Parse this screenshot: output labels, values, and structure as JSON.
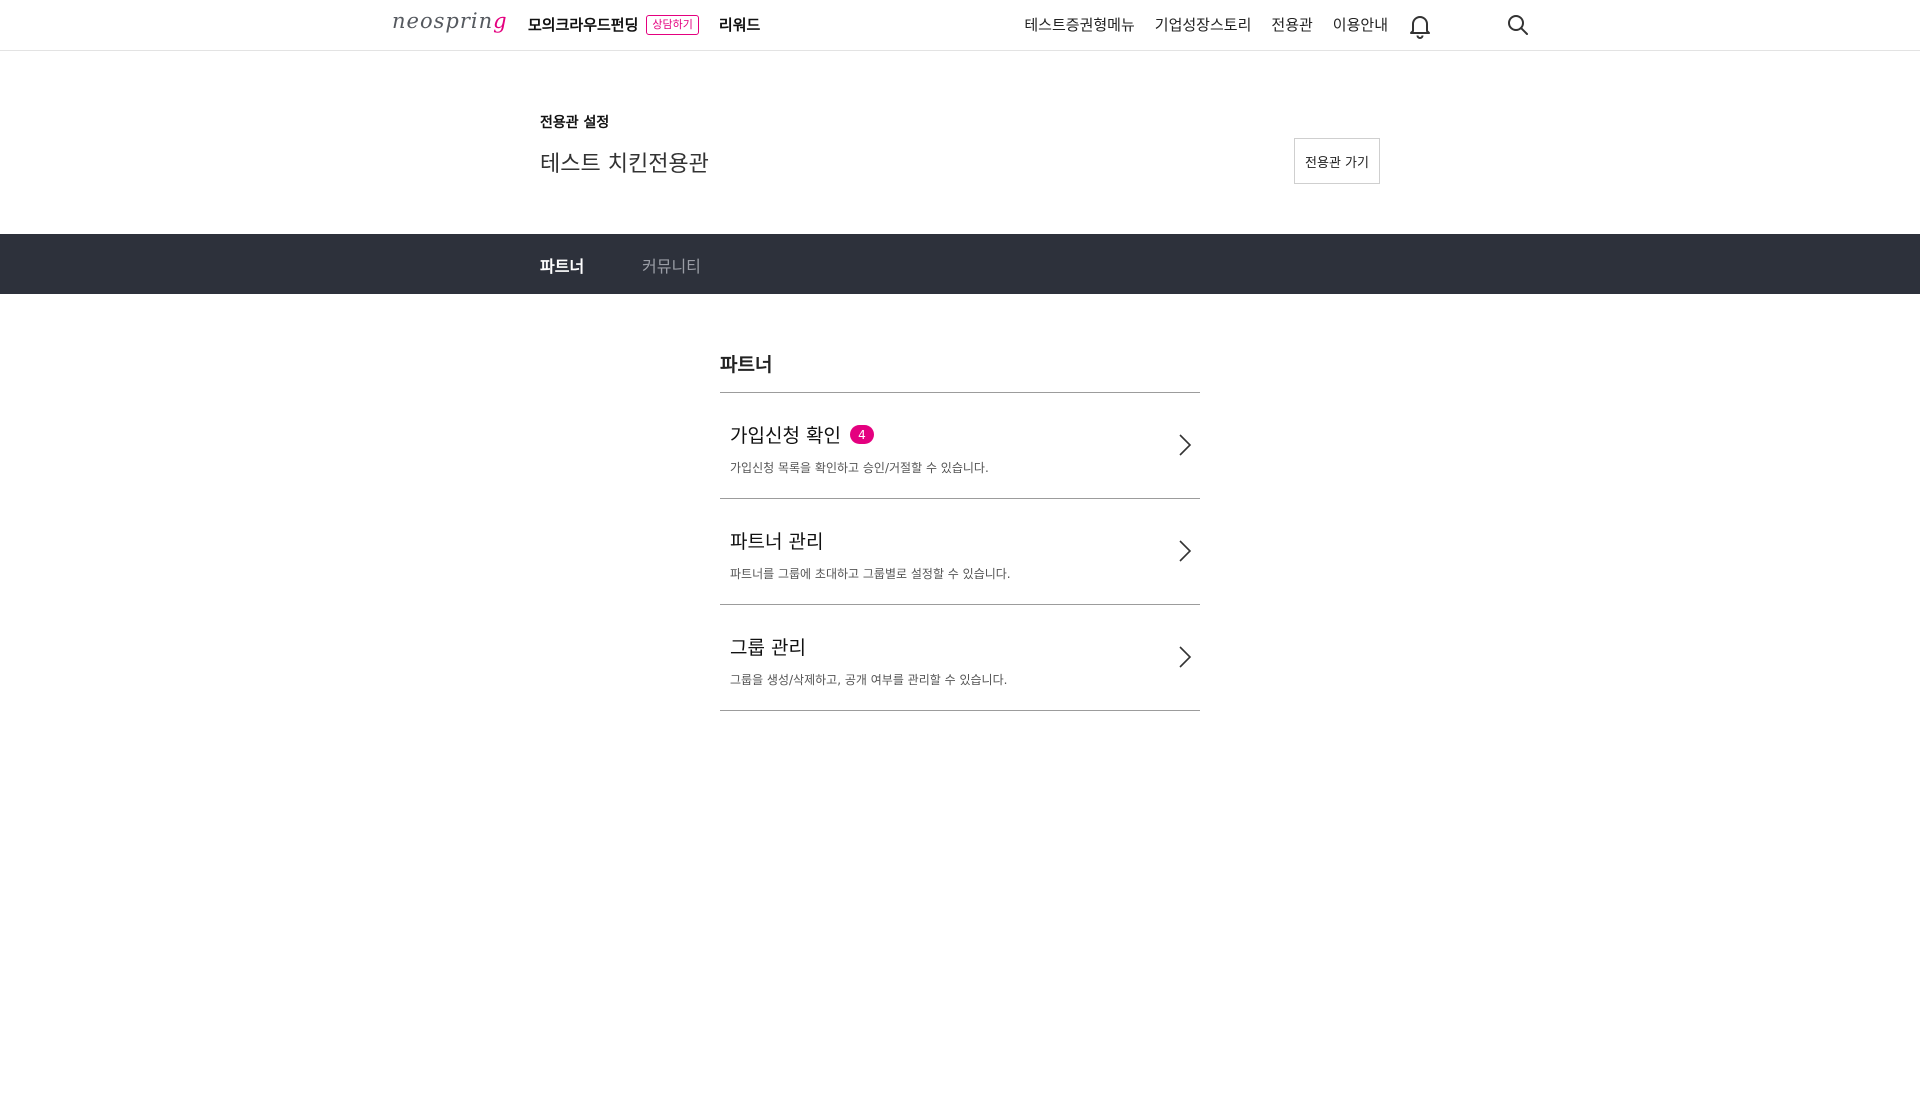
{
  "header": {
    "logo": {
      "main": "neosprin",
      "accent": "g"
    },
    "nav_left": {
      "mock_crowd": "모의크라우드펀딩",
      "consult": "상담하기",
      "reward": "리워드"
    },
    "nav_right": [
      "테스트증권형메뉴",
      "기업성장스토리",
      "전용관",
      "이용안내"
    ],
    "icons": [
      "bell-icon",
      "search-icon"
    ]
  },
  "settings": {
    "crumb": "전용관 설정",
    "title": "테스트 치킨전용관",
    "goto_label": "전용관 가기"
  },
  "tabs": [
    {
      "label": "파트너",
      "active": true
    },
    {
      "label": "커뮤니티",
      "active": false
    }
  ],
  "section": {
    "title": "파트너",
    "rows": [
      {
        "title": "가입신청 확인",
        "badge": "4",
        "desc": "가입신청 목록을 확인하고 승인/거절할 수 있습니다."
      },
      {
        "title": "파트너 관리",
        "desc": "파트너를 그룹에 초대하고 그룹별로 설정할 수 있습니다."
      },
      {
        "title": "그룹 관리",
        "desc": "그룹을 생성/삭제하고, 공개 여부를 관리할 수 있습니다."
      }
    ]
  },
  "colors": {
    "accent": "#e4007f",
    "tabbar_bg": "#2d313b",
    "divider": "#9c9c9c"
  }
}
